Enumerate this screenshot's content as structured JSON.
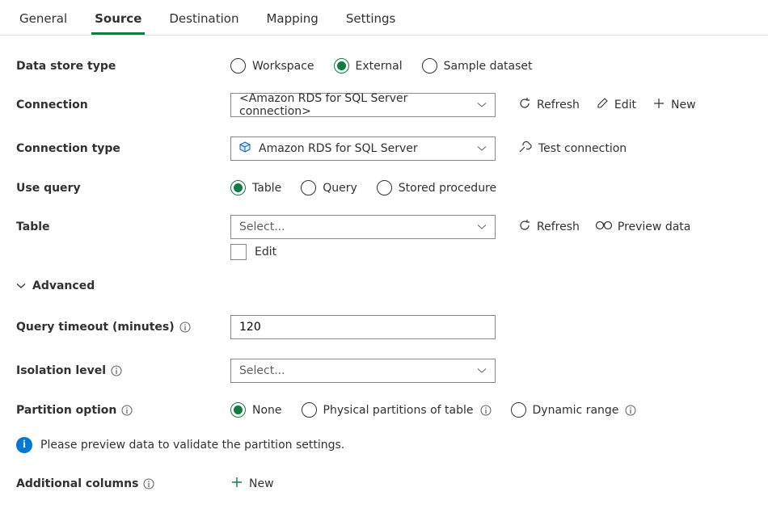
{
  "tabs": {
    "general": "General",
    "source": "Source",
    "destination": "Destination",
    "mapping": "Mapping",
    "settings": "Settings",
    "active": "source"
  },
  "labels": {
    "data_store_type": "Data store type",
    "connection": "Connection",
    "connection_type": "Connection type",
    "use_query": "Use query",
    "table": "Table",
    "advanced": "Advanced",
    "query_timeout": "Query timeout (minutes)",
    "isolation_level": "Isolation level",
    "partition_option": "Partition option",
    "additional_columns": "Additional columns"
  },
  "data_store_type": {
    "workspace": "Workspace",
    "external": "External",
    "sample": "Sample dataset",
    "selected": "external"
  },
  "connection": {
    "value": "<Amazon RDS for SQL Server connection>",
    "refresh": "Refresh",
    "edit": "Edit",
    "new": "New"
  },
  "connection_type": {
    "value": "Amazon RDS for SQL Server",
    "test": "Test connection"
  },
  "use_query": {
    "table": "Table",
    "query": "Query",
    "stored_procedure": "Stored procedure",
    "selected": "table"
  },
  "table": {
    "placeholder": "Select...",
    "edit": "Edit",
    "refresh": "Refresh",
    "preview": "Preview data"
  },
  "query_timeout": {
    "value": "120"
  },
  "isolation_level": {
    "placeholder": "Select..."
  },
  "partition_option": {
    "none": "None",
    "physical": "Physical partitions of table",
    "dynamic": "Dynamic range",
    "selected": "none"
  },
  "info_banner": "Please preview data to validate the partition settings.",
  "additional_columns": {
    "new": "New"
  }
}
